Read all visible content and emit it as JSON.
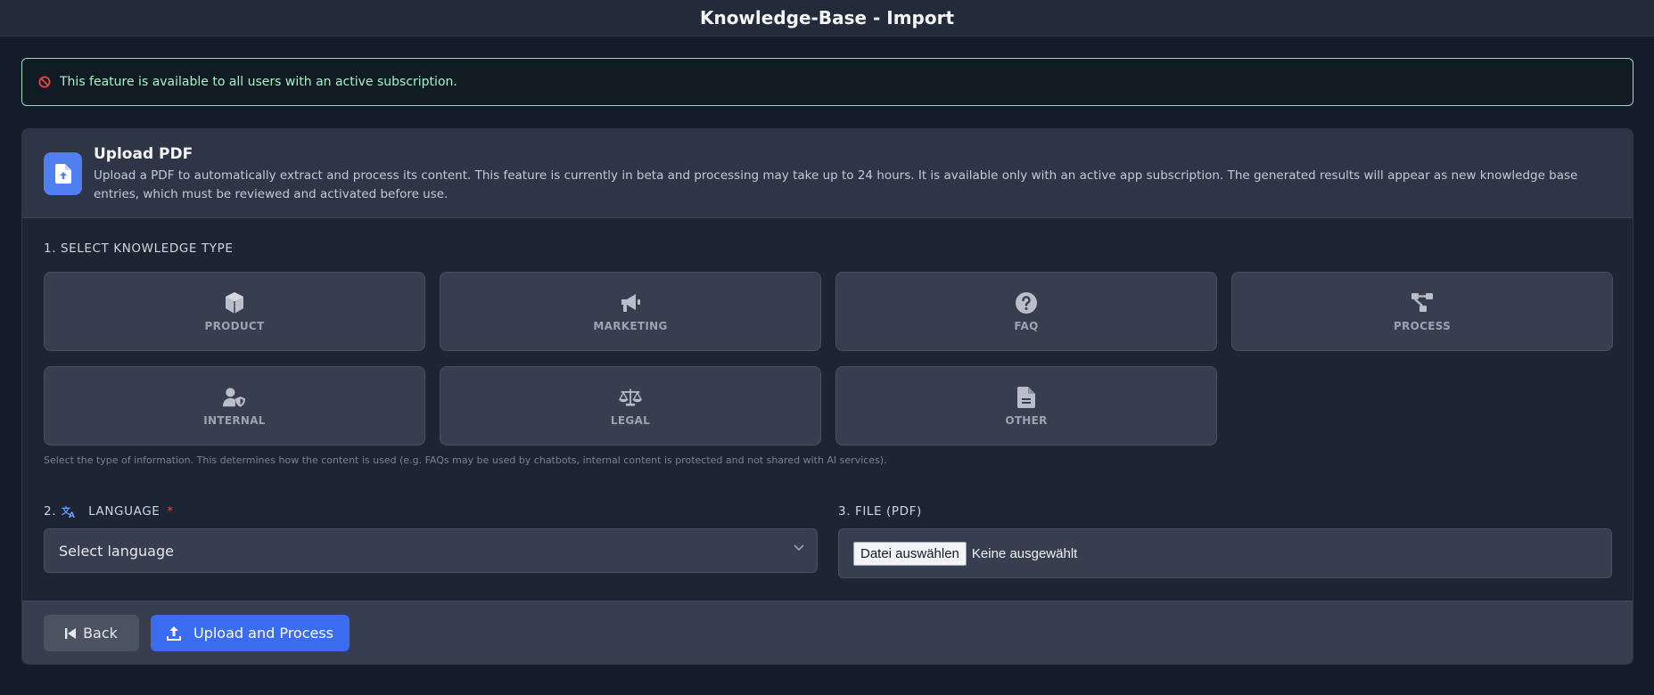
{
  "header": {
    "title": "Knowledge-Base - Import"
  },
  "alert": {
    "message": "This feature is available to all users with an active subscription.",
    "icon": "ban-icon"
  },
  "upload": {
    "title": "Upload PDF",
    "description": "Upload a PDF to automatically extract and process its content. This feature is currently in beta and processing may take up to 24 hours. It is available only with an active app subscription. The generated results will appear as new knowledge base entries, which must be reviewed and activated before use."
  },
  "step1": {
    "label": "1. SELECT KNOWLEDGE TYPE",
    "types": [
      {
        "label": "PRODUCT",
        "icon": "cube-icon"
      },
      {
        "label": "MARKETING",
        "icon": "megaphone-icon"
      },
      {
        "label": "FAQ",
        "icon": "question-circle-icon"
      },
      {
        "label": "PROCESS",
        "icon": "diagram-icon"
      },
      {
        "label": "INTERNAL",
        "icon": "user-shield-icon"
      },
      {
        "label": "LEGAL",
        "icon": "scale-icon"
      },
      {
        "label": "OTHER",
        "icon": "file-text-icon"
      }
    ],
    "hint": "Select the type of information. This determines how the content is used (e.g. FAQs may be used by chatbots, internal content is protected and not shared with AI services)."
  },
  "step2": {
    "number": "2.",
    "label": "LANGUAGE",
    "required_mark": "*",
    "select_value": "Select language"
  },
  "step3": {
    "label": "3. FILE (PDF)",
    "button": "Datei auswählen",
    "status": "Keine ausgewählt"
  },
  "footer": {
    "back_label": "Back",
    "upload_label": "Upload and Process"
  },
  "colors": {
    "accent": "#3b6cf0",
    "alert_border": "#9fd7b9",
    "alert_text": "#a7f3c8",
    "required": "#ef4444"
  }
}
